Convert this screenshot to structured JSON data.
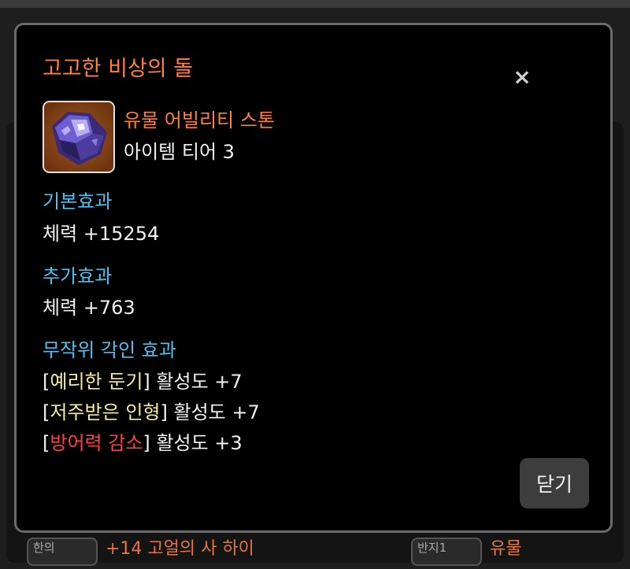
{
  "background": {
    "items": [
      {
        "thumb_label": "한의",
        "text": "+14 고얼의 사 하이"
      },
      {
        "thumb_label": "반지1",
        "text": "유물"
      }
    ]
  },
  "modal": {
    "title": "고고한 비상의 돌",
    "item": {
      "grade": "유물 어빌리티 스톤",
      "tier": "아이템 티어 3",
      "icon": "amethyst-stone-icon"
    },
    "sections": [
      {
        "heading": "기본효과",
        "lines": [
          "체력 +15254"
        ]
      },
      {
        "heading": "추가효과",
        "lines": [
          "체력 +763"
        ]
      }
    ],
    "engravings": {
      "heading": "무작위 각인 효과",
      "items": [
        {
          "name": "예리한 둔기",
          "value": "활성도 +7",
          "color": "#f3ee9a"
        },
        {
          "name": "저주받은 인형",
          "value": "활성도 +7",
          "color": "#f3ee9a"
        },
        {
          "name": "방어력 감소",
          "value": "활성도 +3",
          "color": "#ff4040"
        }
      ]
    },
    "close_button_label": "닫기",
    "close_icon": "×"
  },
  "colors": {
    "accent_orange": "#ff7f3f",
    "section_blue": "#4ec1f2",
    "positive_yellow": "#f3ee9a",
    "negative_red": "#ff4040"
  }
}
